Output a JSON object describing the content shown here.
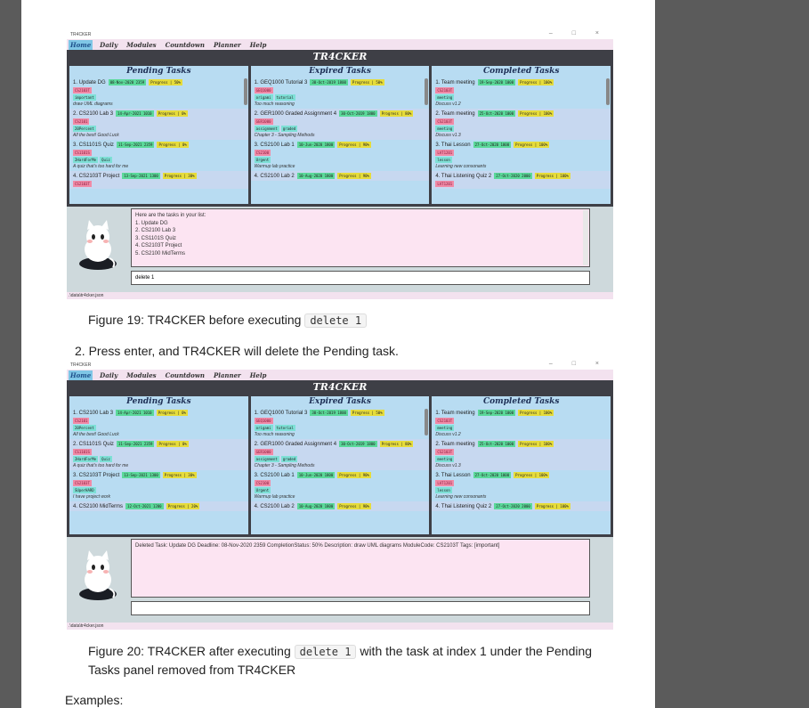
{
  "app": {
    "window_title": "TR4CKER",
    "window_controls": "–  □  ×",
    "menu": [
      "Home",
      "Daily",
      "Modules",
      "Countdown",
      "Planner",
      "Help"
    ],
    "title": "TR4CKER",
    "panel_titles": [
      "Pending Tasks",
      "Expired Tasks",
      "Completed Tasks"
    ],
    "status_path": ".\\data\\tr4cker.json"
  },
  "shot1": {
    "pending": [
      {
        "name": "1. Update DG",
        "deadline": "08-Nov-2020 2359",
        "progress": "Progress | 50%",
        "module": "CS2103T",
        "tags": [
          "important"
        ],
        "desc": "draw UML diagrams"
      },
      {
        "name": "2. CS2100 Lab 3",
        "deadline": "14-Apr-2021 1010",
        "progress": "Progress | 0%",
        "module": "CS2101",
        "tags": [
          "20Percent"
        ],
        "desc": "All the best! Good Luck"
      },
      {
        "name": "3. CS1101S Quiz",
        "deadline": "11-Sep-2021 2359",
        "progress": "Progress | 0%",
        "module": "CS1101S",
        "tags": [
          "2HardForMe",
          "Quiz"
        ],
        "desc": "A quiz that's too hard for me"
      },
      {
        "name": "4. CS2103T Project",
        "deadline": "13-Sep-2021 1300",
        "progress": "Progress | 30%",
        "module": "CS2103T",
        "tags": [],
        "desc": ""
      }
    ],
    "expired": [
      {
        "name": "1. GEQ1000 Tutorial 3",
        "deadline": "30-Oct-2019 1800",
        "progress": "Progress | 50%",
        "module": "GEQ1000",
        "tags": [
          "origami",
          "tutorial"
        ],
        "desc": "Too much reasoning"
      },
      {
        "name": "2. GER1000 Graded Assignment 4",
        "deadline": "30-Oct-2019 1800",
        "progress": "Progress | 80%",
        "module": "GER1000",
        "tags": [
          "assignment",
          "graded"
        ],
        "desc": "Chapter 3 - Sampling Methods"
      },
      {
        "name": "3. CS2100 Lab 1",
        "deadline": "10-Jun-2020 1800",
        "progress": "Progress | 90%",
        "module": "CS2100",
        "tags": [
          "Urgent"
        ],
        "desc": "Warmup lab practice"
      },
      {
        "name": "4. CS2100 Lab 2",
        "deadline": "10-Aug-2020 1800",
        "progress": "Progress | 90%",
        "module": "",
        "tags": [],
        "desc": ""
      }
    ],
    "completed": [
      {
        "name": "1. Team meeting",
        "deadline": "19-Sep-2020 1000",
        "progress": "Progress | 100%",
        "module": "CS2103T",
        "tags": [
          "meeting"
        ],
        "desc": "Discuss v1.2"
      },
      {
        "name": "2. Team meeting",
        "deadline": "25-Oct-2020 1000",
        "progress": "Progress | 100%",
        "module": "CS2103T",
        "tags": [
          "meeting"
        ],
        "desc": "Discuss v1.3"
      },
      {
        "name": "3. Thai Lesson",
        "deadline": "27-Oct-2020 1000",
        "progress": "Progress | 100%",
        "module": "LAT1201",
        "tags": [
          "lesson"
        ],
        "desc": "Learning new consonants"
      },
      {
        "name": "4. Thai Listening Quiz 2",
        "deadline": "27-Oct-2020 2000",
        "progress": "Progress | 100%",
        "module": "LAT1201",
        "tags": [],
        "desc": ""
      }
    ],
    "result_lines": [
      "Here are the tasks in your list:",
      "1. Update DG",
      "2. CS2100 Lab 3",
      "3. CS1101S Quiz",
      "4. CS2103T Project",
      "5. CS2100 MidTerms"
    ],
    "command": "delete 1"
  },
  "shot2": {
    "pending": [
      {
        "name": "1. CS2100 Lab 3",
        "deadline": "14-Apr-2021 1010",
        "progress": "Progress | 0%",
        "module": "CS2101",
        "tags": [
          "20Percent"
        ],
        "desc": "All the best! Good Luck"
      },
      {
        "name": "2. CS1101S Quiz",
        "deadline": "11-Sep-2021 2359",
        "progress": "Progress | 0%",
        "module": "CS1101S",
        "tags": [
          "2HardForMe",
          "Quiz"
        ],
        "desc": "A quiz that's too hard for me"
      },
      {
        "name": "3. CS2103T Project",
        "deadline": "13-Sep-2021 1300",
        "progress": "Progress | 30%",
        "module": "CS2103T",
        "tags": [
          "SUperHARD"
        ],
        "desc": "I have project work"
      },
      {
        "name": "4. CS2100 MidTerms",
        "deadline": "12-Oct-2021 1200",
        "progress": "Progress | 20%",
        "module": "",
        "tags": [],
        "desc": ""
      }
    ],
    "expired": [
      {
        "name": "1. GEQ1000 Tutorial 3",
        "deadline": "30-Oct-2019 1800",
        "progress": "Progress | 50%",
        "module": "GEQ1000",
        "tags": [
          "origami",
          "tutorial"
        ],
        "desc": "Too much reasoning"
      },
      {
        "name": "2. GER1000 Graded Assignment 4",
        "deadline": "30-Oct-2019 1800",
        "progress": "Progress | 80%",
        "module": "GER1000",
        "tags": [
          "assignment",
          "graded"
        ],
        "desc": "Chapter 3 - Sampling Methods"
      },
      {
        "name": "3. CS2100 Lab 1",
        "deadline": "10-Jun-2020 1800",
        "progress": "Progress | 90%",
        "module": "CS2100",
        "tags": [
          "Urgent"
        ],
        "desc": "Warmup lab practice"
      },
      {
        "name": "4. CS2100 Lab 2",
        "deadline": "10-Aug-2020 1800",
        "progress": "Progress | 90%",
        "module": "",
        "tags": [],
        "desc": ""
      }
    ],
    "completed": [
      {
        "name": "1. Team meeting",
        "deadline": "19-Sep-2020 1000",
        "progress": "Progress | 100%",
        "module": "CS2103T",
        "tags": [
          "meeting"
        ],
        "desc": "Discuss v1.2"
      },
      {
        "name": "2. Team meeting",
        "deadline": "25-Oct-2020 1000",
        "progress": "Progress | 100%",
        "module": "CS2103T",
        "tags": [
          "meeting"
        ],
        "desc": "Discuss v1.3"
      },
      {
        "name": "3. Thai Lesson",
        "deadline": "27-Oct-2020 1000",
        "progress": "Progress | 100%",
        "module": "LAT1201",
        "tags": [
          "lesson"
        ],
        "desc": "Learning new consonants"
      },
      {
        "name": "4. Thai Listening Quiz 2",
        "deadline": "27-Oct-2020 2000",
        "progress": "Progress | 100%",
        "module": "",
        "tags": [],
        "desc": ""
      }
    ],
    "result_lines": [
      "Deleted Task: Update DG Deadline: 08-Nov-2020 2359 CompletionStatus: 50% Description: draw UML diagrams ModuleCode: CS2103T Tags: [important]"
    ],
    "command": ""
  },
  "doc": {
    "caption1": "Figure 19: TR4CKER before executing",
    "caption1_code": "delete 1",
    "step2": "2. Press enter, and TR4CKER will delete the Pending task.",
    "caption2_a": "Figure 20: TR4CKER after executing",
    "caption2_code": "delete 1",
    "caption2_b": "with the task at index 1 under the Pending",
    "caption2_c": "Tasks panel removed from TR4CKER",
    "examples": "Examples:"
  }
}
